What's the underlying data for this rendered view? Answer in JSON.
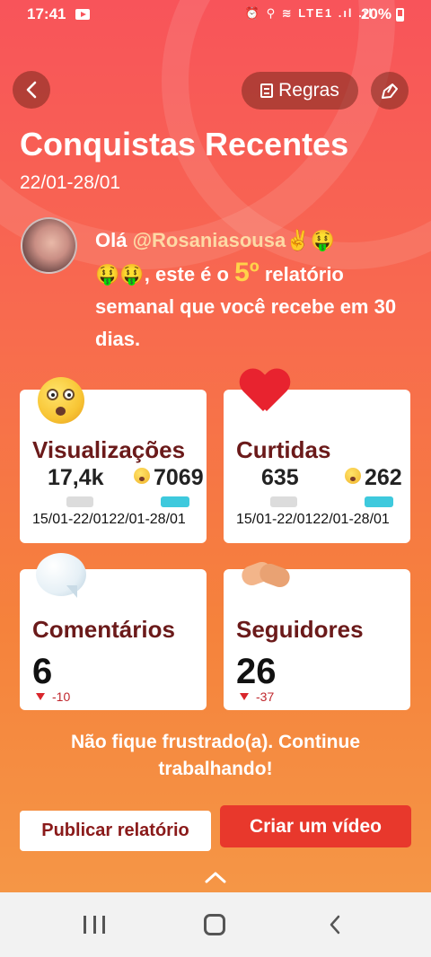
{
  "status_bar": {
    "time": "17:41",
    "icons": "⏰ ⚲ ≋ LTE1 .ıl .ıl",
    "battery": "20%"
  },
  "header": {
    "rules_label": "Regras",
    "title": "Conquistas Recentes",
    "date_range": "22/01-28/01"
  },
  "greeting": {
    "prefix": "Olá ",
    "username": "@Rosaniasousa",
    "emojis_line": "✌️🤑",
    "emojis_line2": "🤑🤑",
    "middle": ", este é o ",
    "report_number": "5º",
    "suffix": " relatório semanal que você recebe em 30 dias."
  },
  "cards": {
    "views": {
      "label": "Visualizações",
      "previous_value": "17,4k",
      "current_value": "7069",
      "previous_period": "15/01-22/01",
      "current_period": "22/01-28/01"
    },
    "likes": {
      "label": "Curtidas",
      "previous_value": "635",
      "current_value": "262",
      "previous_period": "15/01-22/01",
      "current_period": "22/01-28/01"
    },
    "comments": {
      "label": "Comentários",
      "value": "6",
      "change": "-10"
    },
    "followers": {
      "label": "Seguidores",
      "value": "26",
      "change": "-37"
    }
  },
  "motivation": "Não fique frustrado(a). Continue trabalhando!",
  "actions": {
    "publish_label": "Publicar relatório",
    "create_label": "Criar um vídeo"
  },
  "colors": {
    "accent": "#e8382c",
    "card_label": "#6b1a1a",
    "current_bar": "#3ec9dd",
    "negative": "#d9262c"
  }
}
